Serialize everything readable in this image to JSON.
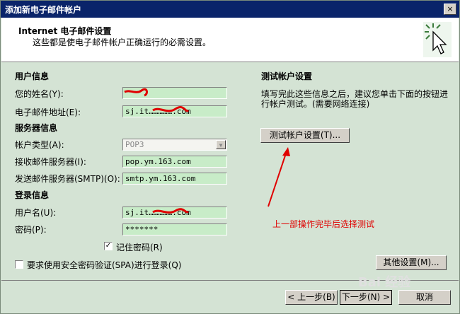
{
  "window": {
    "title": "添加新电子邮件帐户",
    "close_glyph": "×"
  },
  "header": {
    "title": "Internet 电子邮件设置",
    "subtitle": "这些都是使电子邮件帐户正确运行的必需设置。",
    "icon": "cursor-click-icon"
  },
  "user_info": {
    "section": "用户信息",
    "name_label": "您的姓名(Y):",
    "name_value": "",
    "email_label": "电子邮件地址(E):",
    "email_value": "sj.it…………….com"
  },
  "server_info": {
    "section": "服务器信息",
    "account_type_label": "帐户类型(A):",
    "account_type_value": "POP3",
    "incoming_label": "接收邮件服务器(I):",
    "incoming_value": "pop.ym.163.com",
    "outgoing_label": "发送邮件服务器(SMTP)(O):",
    "outgoing_value": "smtp.ym.163.com"
  },
  "login_info": {
    "section": "登录信息",
    "username_label": "用户名(U):",
    "username_value": "sj.it…………….com",
    "password_label": "密码(P):",
    "password_value": "*******",
    "remember_label": "记住密码(R)",
    "remember_checked": true,
    "spa_label": "要求使用安全密码验证(SPA)进行登录(Q)",
    "spa_checked": false
  },
  "test": {
    "section": "测试帐户设置",
    "desc_line1": "填写完此这些信息之后，建议您单击下面的按钮进",
    "desc_line2": "行帐户测试。(需要网络连接)",
    "button": "测试帐户设置(T)..."
  },
  "annotation": {
    "text": "上一部操作完毕后选择测试",
    "color": "#e00000"
  },
  "more_settings_button": "其他设置(M)...",
  "footer": {
    "back": "< 上一步(B)",
    "next": "下一步(N) >",
    "cancel": "取消"
  },
  "watermark": "Bai 经验",
  "colors": {
    "titlebar": "#0a246a",
    "field_bg": "#c8ecc8",
    "dialog_bg": "#d4e3d4"
  }
}
